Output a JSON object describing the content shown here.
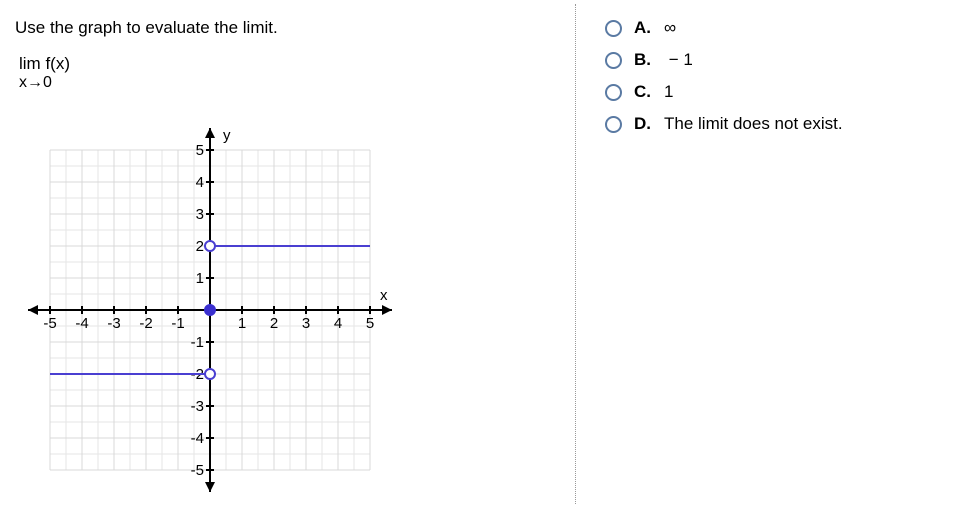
{
  "question": {
    "prompt": "Use the graph to evaluate the limit.",
    "limit_top": "lim f(x)",
    "limit_bottom": "x→0"
  },
  "answers": [
    {
      "letter": "A.",
      "text": "∞"
    },
    {
      "letter": "B.",
      "text": " − 1"
    },
    {
      "letter": "C.",
      "text": "1"
    },
    {
      "letter": "D.",
      "text": "The limit does not exist."
    }
  ],
  "chart_data": {
    "type": "line",
    "title": "",
    "xlabel": "x",
    "ylabel": "y",
    "xlim": [
      -5,
      5
    ],
    "ylim": [
      -5,
      5
    ],
    "xticks": [
      -5,
      -4,
      -3,
      -2,
      -1,
      1,
      2,
      3,
      4,
      5
    ],
    "yticks": [
      -5,
      -4,
      -3,
      -2,
      -1,
      1,
      2,
      3,
      4,
      5
    ],
    "series": [
      {
        "name": "left-branch",
        "segment": [
          [
            -5,
            -2
          ],
          [
            0,
            -2
          ]
        ],
        "open_at": [
          0,
          -2
        ]
      },
      {
        "name": "right-branch",
        "segment": [
          [
            0,
            2
          ],
          [
            5,
            2
          ]
        ],
        "open_at": [
          0,
          2
        ]
      }
    ],
    "points": [
      {
        "coords": [
          0,
          0
        ],
        "filled": true
      }
    ]
  }
}
